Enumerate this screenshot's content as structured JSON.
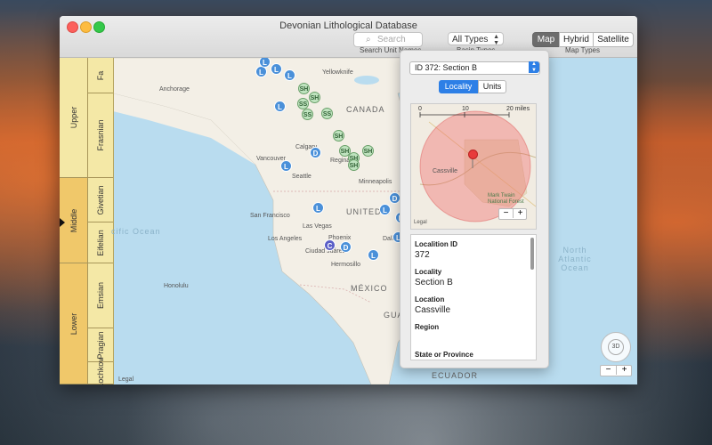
{
  "window": {
    "title": "Devonian Lithological Database"
  },
  "toolbar": {
    "search_placeholder": "Search",
    "search_caption": "Search Unit Names",
    "basin_value": "All Types",
    "basin_caption": "Basin Types",
    "map_types": [
      "Map",
      "Hybrid",
      "Satellite"
    ],
    "map_types_caption": "Map Types"
  },
  "strat": {
    "epochs": [
      "Upper",
      "Middle",
      "Lower"
    ],
    "stages": [
      "Fa",
      "Frasnian",
      "Givetian",
      "Eifelian",
      "Emsian",
      "Pragian",
      "Lochkov"
    ]
  },
  "map": {
    "labels": [
      "Yellowknife",
      "CANADA",
      "Anchorage",
      "Calgary",
      "Regina",
      "Vancouver",
      "Seattle",
      "Minneapolis",
      "UNITED S",
      "San Francisco",
      "Las Vegas",
      "Los Angeles",
      "Dallas",
      "Ciudad Juárez",
      "Phoenix",
      "Hermosillo",
      "MÉXICO",
      "GUATE",
      "ECUADOR",
      "Honolulu",
      "Legal"
    ],
    "oceans": [
      "cific Ocean",
      "North Atlantic Ocean"
    ],
    "pins": [
      "L",
      "L",
      "L",
      "L",
      "SH",
      "SH",
      "SS",
      "SS",
      "L",
      "SS",
      "SH",
      "D",
      "SH",
      "SH",
      "SH",
      "SH",
      "L",
      "D",
      "L",
      "D",
      "L",
      "C",
      "D",
      "L",
      "L"
    ],
    "zoom_minus": "−",
    "zoom_plus": "+",
    "compass_label": "3D"
  },
  "panel": {
    "selected_record": "ID 372: Section B",
    "tabs": [
      "Locality",
      "Units"
    ],
    "minimap": {
      "scale_ticks": [
        "0",
        "10",
        "20 miles"
      ],
      "labels": [
        "Cassville",
        "Mark Twain National Forest",
        "Legal"
      ],
      "zoom_minus": "−",
      "zoom_plus": "+"
    },
    "fields": [
      {
        "label": "Localition ID",
        "value": "372"
      },
      {
        "label": "Locality",
        "value": "Section B"
      },
      {
        "label": "Location",
        "value": "Cassville"
      },
      {
        "label": "Region",
        "value": ""
      },
      {
        "label": "State or Province",
        "value": ""
      }
    ]
  },
  "colors": {
    "accent": "#2d7fe6",
    "pin_blue": "#4a90d9",
    "pin_green": "#bfe3bf",
    "strat_fill": "#f4e8a6",
    "strat_highlight": "#f0c86a"
  }
}
